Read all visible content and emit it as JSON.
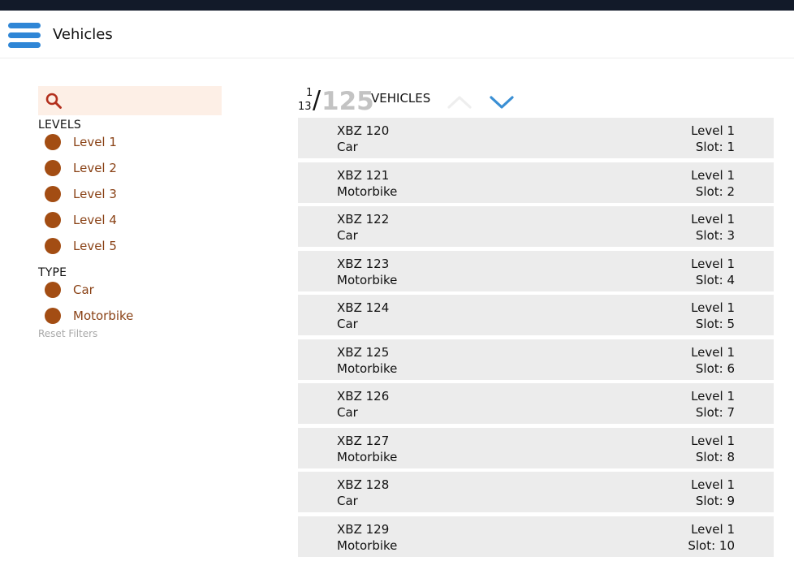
{
  "header": {
    "title": "Vehicles",
    "menu_icon": "hamburger-menu-icon"
  },
  "colors": {
    "topbar": "#121a29",
    "accent_blue": "#2f86d6",
    "filter_dot": "#a34d13",
    "filter_label": "#8a4216",
    "search_bg": "#fdefe6",
    "row_bg": "#ececec",
    "total_count": "#c3c3c3"
  },
  "sidebar": {
    "search": {
      "icon": "search-icon",
      "value": "",
      "placeholder": ""
    },
    "levels_heading": "LEVELS",
    "levels": [
      {
        "label": "Level 1"
      },
      {
        "label": "Level 2"
      },
      {
        "label": "Level 3"
      },
      {
        "label": "Level 4"
      },
      {
        "label": "Level 5"
      }
    ],
    "type_heading": "TYPE",
    "types": [
      {
        "label": "Car"
      },
      {
        "label": "Motorbike"
      }
    ],
    "reset_label": "Reset Filters"
  },
  "list": {
    "page_current": "1",
    "page_total": "13",
    "slash": "/",
    "total_count": "125",
    "count_label": "VEHICLES",
    "nav_up_icon": "chevron-up-icon",
    "nav_down_icon": "chevron-down-icon",
    "vehicles": [
      {
        "plate": "XBZ 120",
        "type": "Car",
        "level": "Level 1",
        "slot": "Slot: 1"
      },
      {
        "plate": "XBZ 121",
        "type": "Motorbike",
        "level": "Level 1",
        "slot": "Slot: 2"
      },
      {
        "plate": "XBZ 122",
        "type": "Car",
        "level": "Level 1",
        "slot": "Slot: 3"
      },
      {
        "plate": "XBZ 123",
        "type": "Motorbike",
        "level": "Level 1",
        "slot": "Slot: 4"
      },
      {
        "plate": "XBZ 124",
        "type": "Car",
        "level": "Level 1",
        "slot": "Slot: 5"
      },
      {
        "plate": "XBZ 125",
        "type": "Motorbike",
        "level": "Level 1",
        "slot": "Slot: 6"
      },
      {
        "plate": "XBZ 126",
        "type": "Car",
        "level": "Level 1",
        "slot": "Slot: 7"
      },
      {
        "plate": "XBZ 127",
        "type": "Motorbike",
        "level": "Level 1",
        "slot": "Slot: 8"
      },
      {
        "plate": "XBZ 128",
        "type": "Car",
        "level": "Level 1",
        "slot": "Slot: 9"
      },
      {
        "plate": "XBZ 129",
        "type": "Motorbike",
        "level": "Level 1",
        "slot": "Slot: 10"
      }
    ]
  }
}
